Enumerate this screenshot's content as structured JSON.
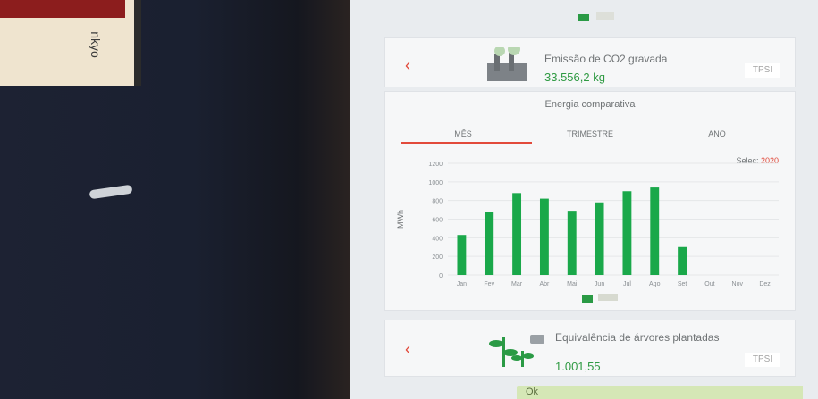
{
  "background": {
    "box_text": "nkyo"
  },
  "emission_card": {
    "title": "Emissão de CO2 gravada",
    "value": "33.556,2 kg",
    "brand": "TPSI"
  },
  "chart_card": {
    "title": "Energia comparativa",
    "tabs": [
      "MÊS",
      "TRIMESTRE",
      "ANO"
    ],
    "active_tab": "MÊS",
    "year_label": "Selec:",
    "year_value": "2020"
  },
  "chart_data": {
    "type": "bar",
    "categories": [
      "Jan",
      "Fev",
      "Mar",
      "Abr",
      "Mai",
      "Jun",
      "Jul",
      "Ago",
      "Set",
      "Out",
      "Nov",
      "Dez"
    ],
    "values": [
      430,
      680,
      880,
      820,
      690,
      780,
      900,
      940,
      300,
      0,
      0,
      0
    ],
    "ylabel": "MWh",
    "yticks": [
      0,
      200,
      400,
      600,
      800,
      1000,
      1200
    ],
    "ylim": [
      0,
      1200
    ],
    "colors": {
      "bars": "#1aa84a"
    }
  },
  "tree_card": {
    "title": "Equivalência de árvores plantadas",
    "value": "1.001,55",
    "brand": "TPSI"
  },
  "bottom_bar": {
    "text": "Ok"
  }
}
